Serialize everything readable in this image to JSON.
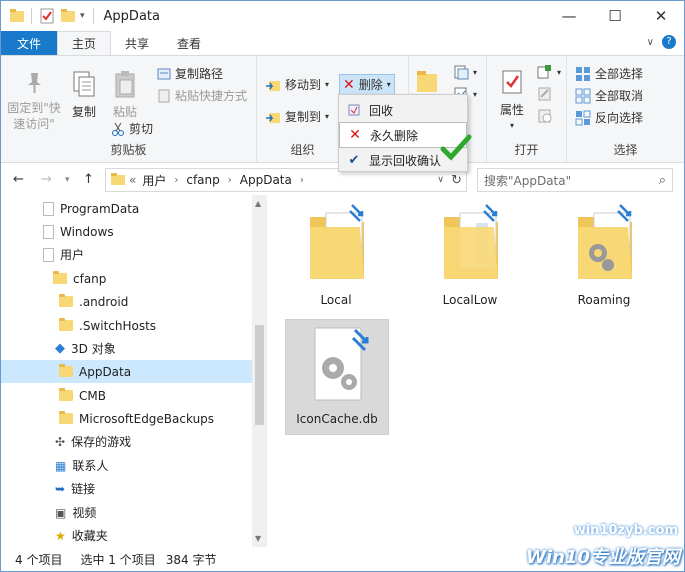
{
  "window": {
    "title": "AppData"
  },
  "tabs": {
    "file": "文件",
    "home": "主页",
    "share": "共享",
    "view": "查看"
  },
  "ribbon": {
    "clipboard": {
      "pin": "固定到\"快\n速访问\"",
      "copy": "复制",
      "paste": "粘贴",
      "copy_path": "复制路径",
      "paste_shortcut": "粘贴快捷方式",
      "cut": "剪切",
      "group": "剪贴板"
    },
    "organize": {
      "move_to": "移动到",
      "copy_to": "复制到",
      "delete": "删除",
      "group": "组织"
    },
    "open": {
      "properties": "属性",
      "group": "打开"
    },
    "select": {
      "select_all": "全部选择",
      "select_none": "全部取消",
      "invert": "反向选择",
      "group": "选择"
    }
  },
  "delete_menu": {
    "items": [
      "回收",
      "永久删除",
      "显示回收确认"
    ]
  },
  "address": {
    "prefix": "«",
    "crumbs": [
      "用户",
      "cfanp",
      "AppData"
    ],
    "search_placeholder": "搜索\"AppData\""
  },
  "nav": {
    "items": [
      "ProgramData",
      "Windows",
      "用户",
      "cfanp",
      ".android",
      ".SwitchHosts",
      "3D 对象",
      "AppData",
      "CMB",
      "MicrosoftEdgeBackups",
      "保存的游戏",
      "联系人",
      "链接",
      "视频",
      "收藏夹"
    ]
  },
  "files": [
    {
      "name": "Local"
    },
    {
      "name": "LocalLow"
    },
    {
      "name": "Roaming"
    },
    {
      "name": "IconCache.db"
    }
  ],
  "status": {
    "count": "4 个项目",
    "selected": "选中 1 个项目",
    "size": "384 字节"
  },
  "watermark": {
    "url": "win10zyb.com",
    "brand": "Win10专业版官网"
  }
}
